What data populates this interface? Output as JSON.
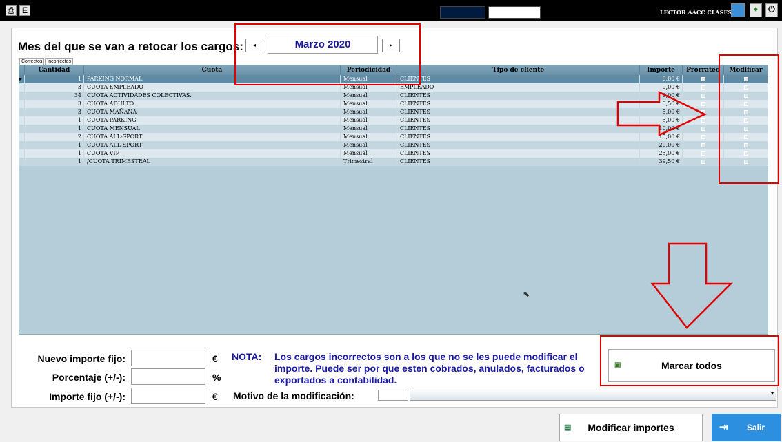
{
  "topbar": {
    "letter_btn": "E",
    "lector_label": "LECTOR AACC CLASES"
  },
  "header": {
    "title": "Mes del que se van a retocar los cargos:",
    "month": "Marzo 2020",
    "prev": "◂",
    "next": "▸"
  },
  "tabs": [
    "Correctos",
    "Incorrectos"
  ],
  "columns": [
    "Cantidad",
    "Cuota",
    "Periodicidad",
    "Tipo de cliente",
    "Importe",
    "Prorrateo",
    "Modificar"
  ],
  "rows": [
    {
      "qty": "1",
      "cuota": "PARKING NORMAL",
      "per": "Mensual",
      "tipo": "CLIENTES",
      "imp": "0,00 €"
    },
    {
      "qty": "3",
      "cuota": "CUOTA EMPLEADO",
      "per": "Mensual",
      "tipo": "EMPLEADO",
      "imp": "0,00 €"
    },
    {
      "qty": "34",
      "cuota": "CUOTA ACTIVIDADES COLECTIVAS.",
      "per": "Mensual",
      "tipo": "CLIENTES",
      "imp": "0,00 €"
    },
    {
      "qty": "3",
      "cuota": "CUOTA ADULTO",
      "per": "Mensual",
      "tipo": "CLIENTES",
      "imp": "0,50 €"
    },
    {
      "qty": "3",
      "cuota": "CUOTA MAÑANA",
      "per": "Mensual",
      "tipo": "CLIENTES",
      "imp": "5,00 €"
    },
    {
      "qty": "1",
      "cuota": "CUOTA PARKING",
      "per": "Mensual",
      "tipo": "CLIENTES",
      "imp": "5,00 €"
    },
    {
      "qty": "1",
      "cuota": "CUOTA MENSUAL",
      "per": "Mensual",
      "tipo": "CLIENTES",
      "imp": "10,00 €"
    },
    {
      "qty": "2",
      "cuota": "CUOTA ALL-SPORT",
      "per": "Mensual",
      "tipo": "CLIENTES",
      "imp": "15,00 €"
    },
    {
      "qty": "1",
      "cuota": "CUOTA ALL-SPORT",
      "per": "Mensual",
      "tipo": "CLIENTES",
      "imp": "20,00 €"
    },
    {
      "qty": "1",
      "cuota": "CUOTA VIP",
      "per": "Mensual",
      "tipo": "CLIENTES",
      "imp": "25,00 €"
    },
    {
      "qty": "1",
      "cuota": "/CUOTA TRIMESTRAL",
      "per": "Trimestral",
      "tipo": "CLIENTES",
      "imp": "39,50 €"
    }
  ],
  "form": {
    "nuevo_label": "Nuevo importe fijo:",
    "porcentaje_label": "Porcentaje (+/-):",
    "importe_label": "Importe fijo (+/-):",
    "euro": "€",
    "percent": "%",
    "nota_title": "NOTA:",
    "nota_text": "Los cargos incorrectos son a los que no se les puede modificar el importe. Puede ser por que esten cobrados, anulados, facturados o exportados a contabilidad.",
    "motivo_label": "Motivo de la modificación:"
  },
  "buttons": {
    "marcar": "Marcar todos",
    "modificar": "Modificar importes",
    "salir": "Salir"
  },
  "colors": {
    "accent_blue": "#1a1aa6",
    "highlight_red": "#e00000",
    "grid_bg": "#b4cdd9",
    "salir_bg": "#2d8fe0"
  }
}
